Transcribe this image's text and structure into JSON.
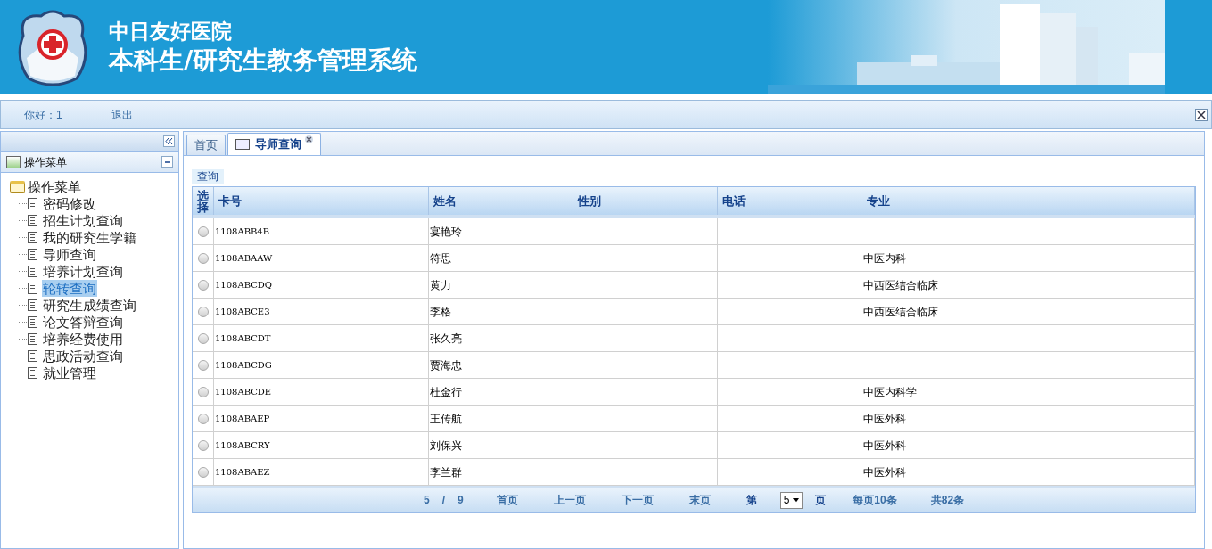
{
  "header": {
    "hospital": "中日友好医院",
    "system": "本科生/研究生教务管理系统"
  },
  "toolbar": {
    "greeting": "你好：1",
    "logout": "退出"
  },
  "sidebar": {
    "panel_title": "操作菜单",
    "tree": {
      "label": "操作菜单",
      "expanded": true,
      "children": [
        {
          "label": "密码修改",
          "selected": false
        },
        {
          "label": "招生计划查询",
          "selected": false
        },
        {
          "label": "我的研究生学籍",
          "selected": false
        },
        {
          "label": "导师查询",
          "selected": false
        },
        {
          "label": "培养计划查询",
          "selected": false
        },
        {
          "label": "轮转查询",
          "selected": true
        },
        {
          "label": "研究生成绩查询",
          "selected": false
        },
        {
          "label": "论文答辩查询",
          "selected": false
        },
        {
          "label": "培养经费使用",
          "selected": false
        },
        {
          "label": "思政活动查询",
          "selected": false
        },
        {
          "label": "就业管理",
          "selected": false
        }
      ]
    }
  },
  "tabs": [
    {
      "label": "首页",
      "selected": false,
      "closable": false
    },
    {
      "label": "导师查询",
      "selected": true,
      "closable": true
    }
  ],
  "query_label": "查询",
  "table": {
    "columns": [
      "选择",
      "卡号",
      "姓名",
      "性别",
      "电话",
      "专业"
    ],
    "rows": [
      {
        "selected": false,
        "cells": [
          "",
          "1108ABB4B",
          "宴艳玲",
          "",
          "",
          ""
        ]
      },
      {
        "selected": false,
        "cells": [
          "",
          "1108ABAAW",
          "符思",
          "",
          "",
          "中医内科"
        ]
      },
      {
        "selected": false,
        "cells": [
          "",
          "1108ABCDQ",
          "黄力",
          "",
          "",
          "中西医结合临床"
        ]
      },
      {
        "selected": false,
        "cells": [
          "",
          "1108ABCE3",
          "李格",
          "",
          "",
          "中西医结合临床"
        ]
      },
      {
        "selected": false,
        "cells": [
          "",
          "1108ABCDT",
          "张久亮",
          "",
          "",
          ""
        ]
      },
      {
        "selected": false,
        "cells": [
          "",
          "1108ABCDG",
          "贾海忠",
          "",
          "",
          ""
        ]
      },
      {
        "selected": false,
        "cells": [
          "",
          "1108ABCDE",
          "杜金行",
          "",
          "",
          "中医内科学"
        ]
      },
      {
        "selected": false,
        "cells": [
          "",
          "1108ABAEP",
          "王传航",
          "",
          "",
          "中医外科"
        ]
      },
      {
        "selected": false,
        "cells": [
          "",
          "1108ABCRY",
          "刘保兴",
          "",
          "",
          "中医外科"
        ]
      },
      {
        "selected": false,
        "cells": [
          "",
          "1108ABAEZ",
          "李兰群",
          "",
          "",
          "中医外科"
        ]
      }
    ]
  },
  "pager": {
    "current": "5",
    "separator": "/",
    "total_pages": "9",
    "first": "首页",
    "prev": "上一页",
    "next": "下一页",
    "last": "末页",
    "page_prefix": "第",
    "page_select": "5",
    "page_suffix": "页",
    "per_page": "每页10条",
    "total": "共82条"
  }
}
